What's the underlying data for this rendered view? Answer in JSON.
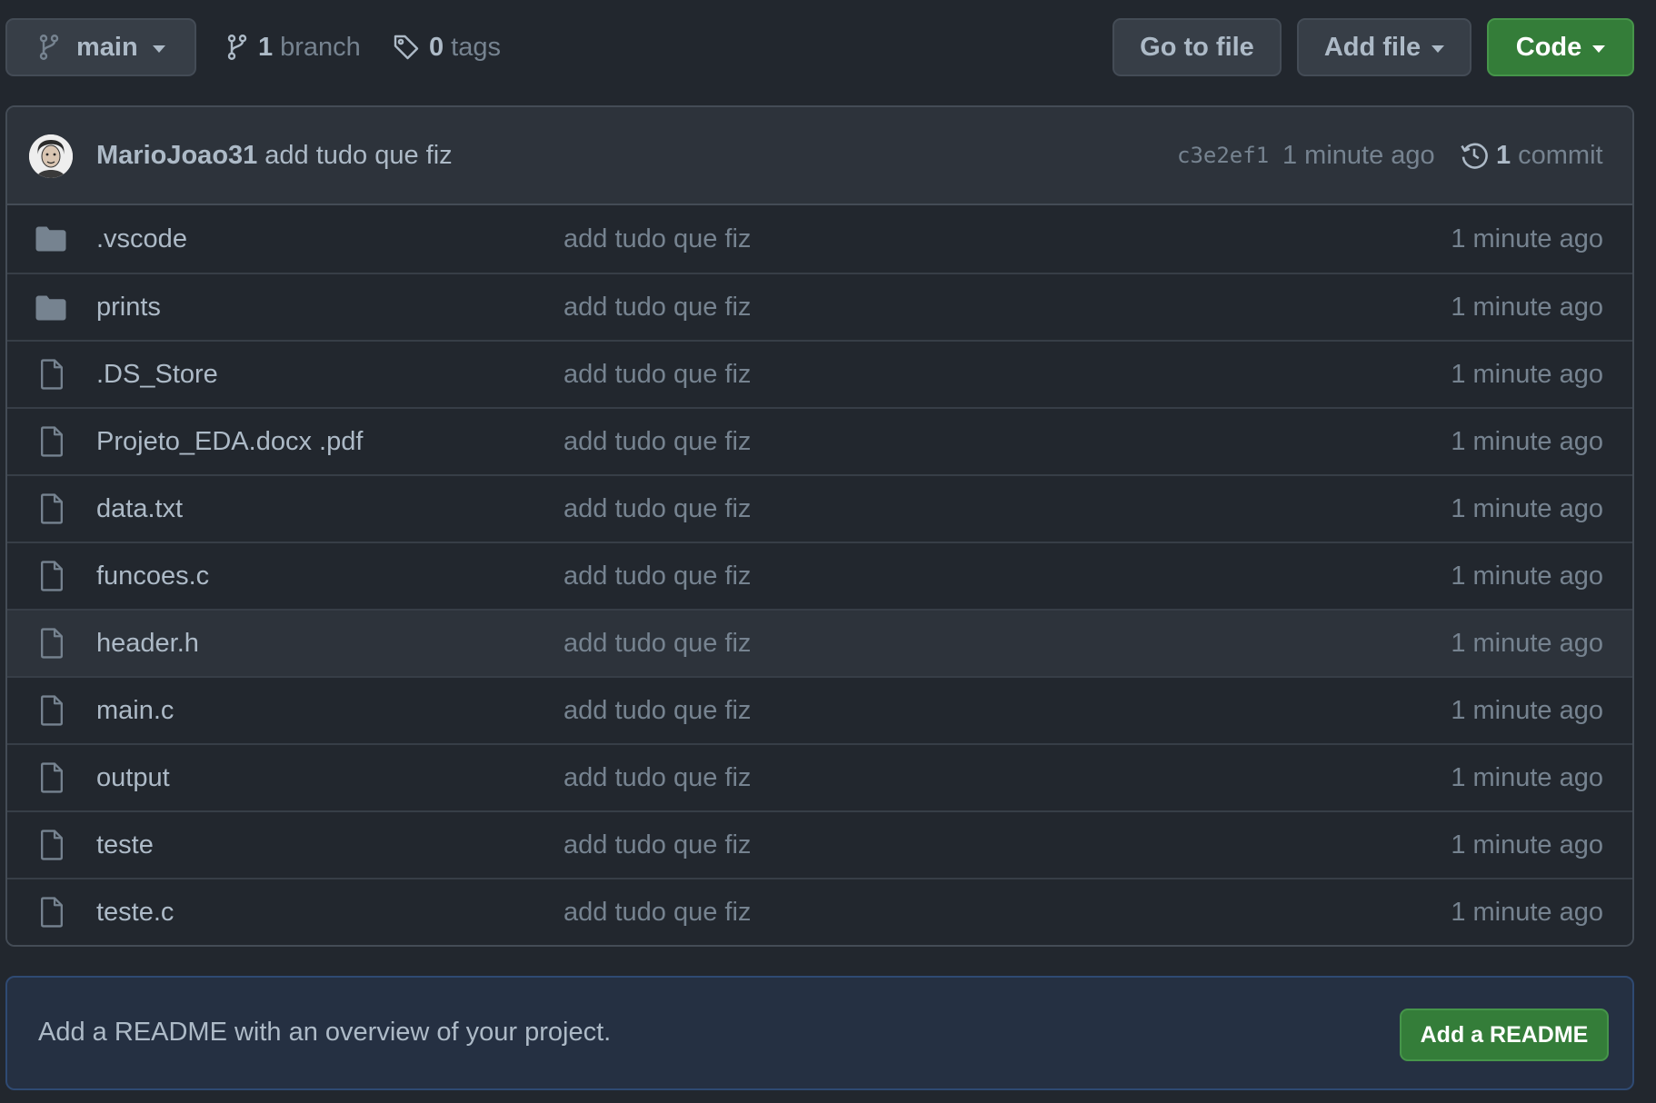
{
  "toolbar": {
    "branch_label": "main",
    "branches_count": "1",
    "branches_word": "branch",
    "tags_count": "0",
    "tags_word": "tags",
    "goto_file_label": "Go to file",
    "add_file_label": "Add file",
    "code_label": "Code"
  },
  "commit": {
    "author": "MarioJoao31",
    "message": "add tudo que fiz",
    "hash": "c3e2ef1",
    "time": "1 minute ago",
    "count": "1",
    "count_word": "commit"
  },
  "files": [
    {
      "name": ".vscode",
      "type": "folder",
      "commit": "add tudo que fiz",
      "time": "1 minute ago"
    },
    {
      "name": "prints",
      "type": "folder",
      "commit": "add tudo que fiz",
      "time": "1 minute ago"
    },
    {
      "name": ".DS_Store",
      "type": "file",
      "commit": "add tudo que fiz",
      "time": "1 minute ago"
    },
    {
      "name": "Projeto_EDA.docx .pdf",
      "type": "file",
      "commit": "add tudo que fiz",
      "time": "1 minute ago"
    },
    {
      "name": "data.txt",
      "type": "file",
      "commit": "add tudo que fiz",
      "time": "1 minute ago"
    },
    {
      "name": "funcoes.c",
      "type": "file",
      "commit": "add tudo que fiz",
      "time": "1 minute ago"
    },
    {
      "name": "header.h",
      "type": "file",
      "commit": "add tudo que fiz",
      "time": "1 minute ago"
    },
    {
      "name": "main.c",
      "type": "file",
      "commit": "add tudo que fiz",
      "time": "1 minute ago"
    },
    {
      "name": "output",
      "type": "file",
      "commit": "add tudo que fiz",
      "time": "1 minute ago"
    },
    {
      "name": "teste",
      "type": "file",
      "commit": "add tudo que fiz",
      "time": "1 minute ago"
    },
    {
      "name": "teste.c",
      "type": "file",
      "commit": "add tudo que fiz",
      "time": "1 minute ago"
    }
  ],
  "readme": {
    "text": "Add a README with an overview of your project.",
    "button_label": "Add a README"
  },
  "colors": {
    "background": "#22272e",
    "header_bg": "#2d333b",
    "border": "#444c56",
    "text_primary": "#adbac7",
    "text_muted": "#768390",
    "green": "#347d39",
    "readme_bg": "#253042"
  },
  "icons": {
    "branch": "git-branch-icon",
    "tag": "tag-icon",
    "history": "history-icon",
    "folder": "folder-icon",
    "file": "file-icon"
  }
}
